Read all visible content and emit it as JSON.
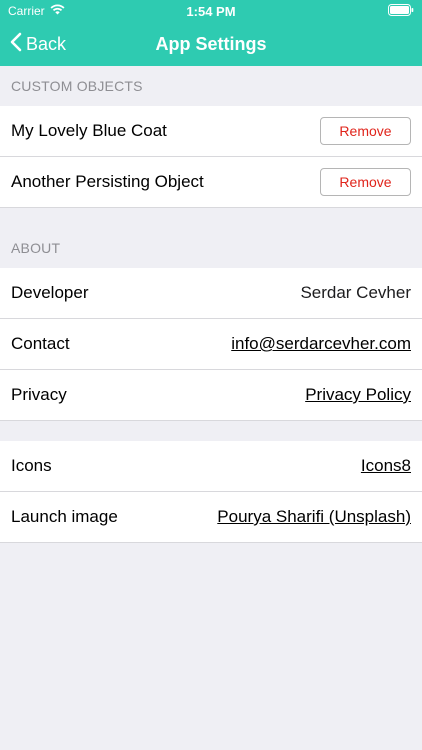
{
  "status": {
    "carrier": "Carrier",
    "time": "1:54 PM"
  },
  "nav": {
    "back_label": "Back",
    "title": "App Settings"
  },
  "custom_objects": {
    "header": "CUSTOM OBJECTS",
    "remove_label": "Remove",
    "items": [
      {
        "name": "My Lovely Blue Coat"
      },
      {
        "name": "Another Persisting Object"
      }
    ]
  },
  "about": {
    "header": "ABOUT",
    "rows": [
      {
        "label": "Developer",
        "value": "Serdar Cevher"
      },
      {
        "label": "Contact",
        "value": "info@serdarcevher.com"
      },
      {
        "label": "Privacy",
        "value": "Privacy Policy"
      }
    ]
  },
  "credits": {
    "rows": [
      {
        "label": "Icons",
        "value": "Icons8"
      },
      {
        "label": "Launch image",
        "value": "Pourya Sharifi (Unsplash)"
      }
    ]
  },
  "colors": {
    "accent": "#2ecbb1",
    "remove_text": "#e0241b",
    "background": "#efeff4"
  },
  "icons": {
    "wifi": "wifi-icon",
    "battery": "battery-icon",
    "back": "chevron-left-icon"
  }
}
